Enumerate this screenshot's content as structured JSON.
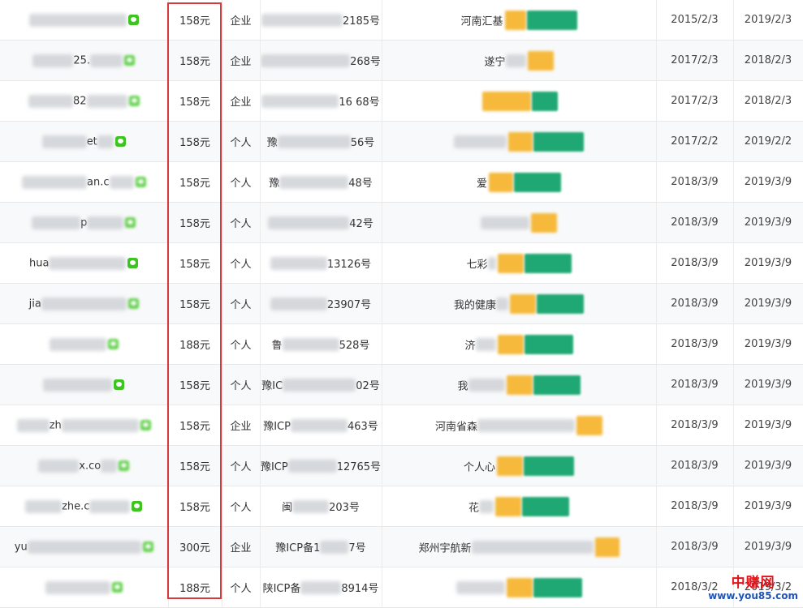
{
  "colors": {
    "highlight_border": "#d9383a",
    "watermark_brand": "#e0141b",
    "watermark_url": "#1f54b6",
    "tag_orange": "#f6b93b",
    "tag_green": "#1fa874",
    "wechat_green": "#3cc51f"
  },
  "rows": [
    {
      "domain_frag": "",
      "price": "158元",
      "type": "企业",
      "icp_pre": "",
      "icp_suf": "2185号",
      "name_pre": "河南汇基",
      "registered": "2015/2/3",
      "expires": "2019/2/3"
    },
    {
      "domain_frag": "25.",
      "price": "158元",
      "type": "企业",
      "icp_pre": "",
      "icp_suf": "268号",
      "name_pre": "遂宁",
      "registered": "2017/2/3",
      "expires": "2018/2/3"
    },
    {
      "domain_frag": "82",
      "price": "158元",
      "type": "企业",
      "icp_pre": "",
      "icp_suf": "16 68号",
      "name_pre": "",
      "registered": "2017/2/3",
      "expires": "2018/2/3"
    },
    {
      "domain_frag": "et",
      "price": "158元",
      "type": "个人",
      "icp_pre": "豫",
      "icp_suf": "56号",
      "name_pre": "",
      "registered": "2017/2/2",
      "expires": "2019/2/2"
    },
    {
      "domain_frag": "an.c",
      "price": "158元",
      "type": "个人",
      "icp_pre": "豫",
      "icp_suf": "48号",
      "name_pre": "爱",
      "registered": "2018/3/9",
      "expires": "2019/3/9"
    },
    {
      "domain_frag": "p",
      "price": "158元",
      "type": "个人",
      "icp_pre": "",
      "icp_suf": "42号",
      "name_pre": "",
      "registered": "2018/3/9",
      "expires": "2019/3/9"
    },
    {
      "domain_frag": "hua",
      "price": "158元",
      "type": "个人",
      "icp_pre": "",
      "icp_suf": "13126号",
      "name_pre": "七彩",
      "registered": "2018/3/9",
      "expires": "2019/3/9"
    },
    {
      "domain_frag": "jia",
      "price": "158元",
      "type": "个人",
      "icp_pre": "",
      "icp_suf": "23907号",
      "name_pre": "我的健康",
      "registered": "2018/3/9",
      "expires": "2019/3/9"
    },
    {
      "domain_frag": "",
      "price": "188元",
      "type": "个人",
      "icp_pre": "鲁",
      "icp_suf": "528号",
      "name_pre": "济",
      "registered": "2018/3/9",
      "expires": "2019/3/9"
    },
    {
      "domain_frag": "",
      "price": "158元",
      "type": "个人",
      "icp_pre": "豫IC",
      "icp_suf": "02号",
      "name_pre": "我",
      "registered": "2018/3/9",
      "expires": "2019/3/9"
    },
    {
      "domain_frag": "zh",
      "price": "158元",
      "type": "企业",
      "icp_pre": "豫ICP",
      "icp_suf": "463号",
      "name_pre": "河南省森",
      "registered": "2018/3/9",
      "expires": "2019/3/9"
    },
    {
      "domain_frag": "x.co",
      "price": "158元",
      "type": "个人",
      "icp_pre": "豫ICP",
      "icp_suf": "12765号",
      "name_pre": "个人心",
      "registered": "2018/3/9",
      "expires": "2019/3/9"
    },
    {
      "domain_frag": "zhe.c",
      "price": "158元",
      "type": "个人",
      "icp_pre": "闽",
      "icp_suf": "203号",
      "name_pre": "花",
      "registered": "2018/3/9",
      "expires": "2019/3/9"
    },
    {
      "domain_frag": "yu",
      "price": "300元",
      "type": "企业",
      "icp_pre": "豫ICP备1",
      "icp_suf": "7号",
      "name_pre": "郑州宇航新",
      "registered": "2018/3/9",
      "expires": "2019/3/9"
    },
    {
      "domain_frag": "",
      "price": "188元",
      "type": "个人",
      "icp_pre": "陕ICP备",
      "icp_suf": "8914号",
      "name_pre": "",
      "registered": "2018/3/2",
      "expires": "2019/3/2"
    }
  ],
  "watermark": {
    "brand": "中赚网",
    "url": "www.you85.com"
  }
}
